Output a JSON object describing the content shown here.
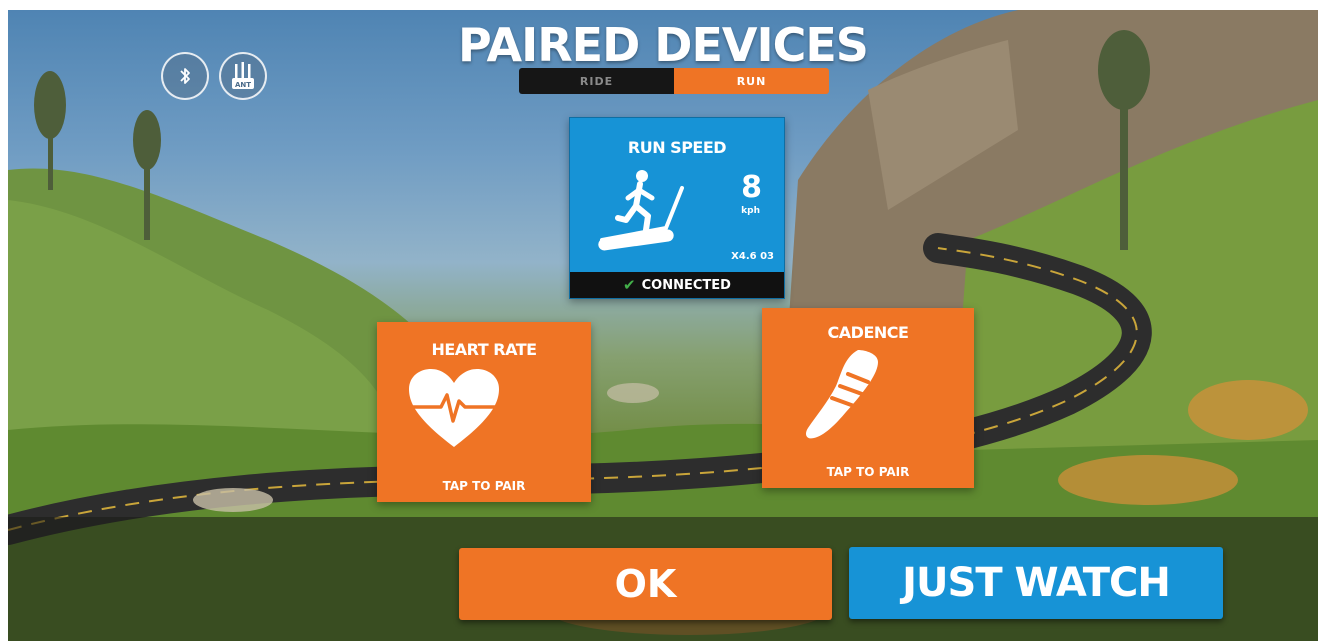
{
  "header": {
    "title": "PAIRED DEVICES",
    "tabs": [
      {
        "label": "RIDE",
        "active": false
      },
      {
        "label": "RUN",
        "active": true
      }
    ]
  },
  "connection_icons": {
    "bluetooth": {
      "icon": "bluetooth-icon"
    },
    "ant": {
      "icon": "ant-plus-icon",
      "label": "ANT"
    }
  },
  "devices": {
    "run_speed": {
      "title": "RUN SPEED",
      "value": "8",
      "unit": "kph",
      "device_id": "X4.6 03",
      "status": "CONNECTED",
      "icon": "treadmill-runner-icon"
    },
    "heart_rate": {
      "title": "HEART RATE",
      "status": "TAP TO PAIR",
      "icon": "heart-rate-icon"
    },
    "cadence": {
      "title": "CADENCE",
      "status": "TAP TO PAIR",
      "icon": "shoe-icon"
    }
  },
  "actions": {
    "ok_label": "OK",
    "just_watch_label": "JUST WATCH"
  },
  "colors": {
    "orange": "#ef7425",
    "blue": "#1793d6",
    "connected_green": "#43b04a"
  }
}
